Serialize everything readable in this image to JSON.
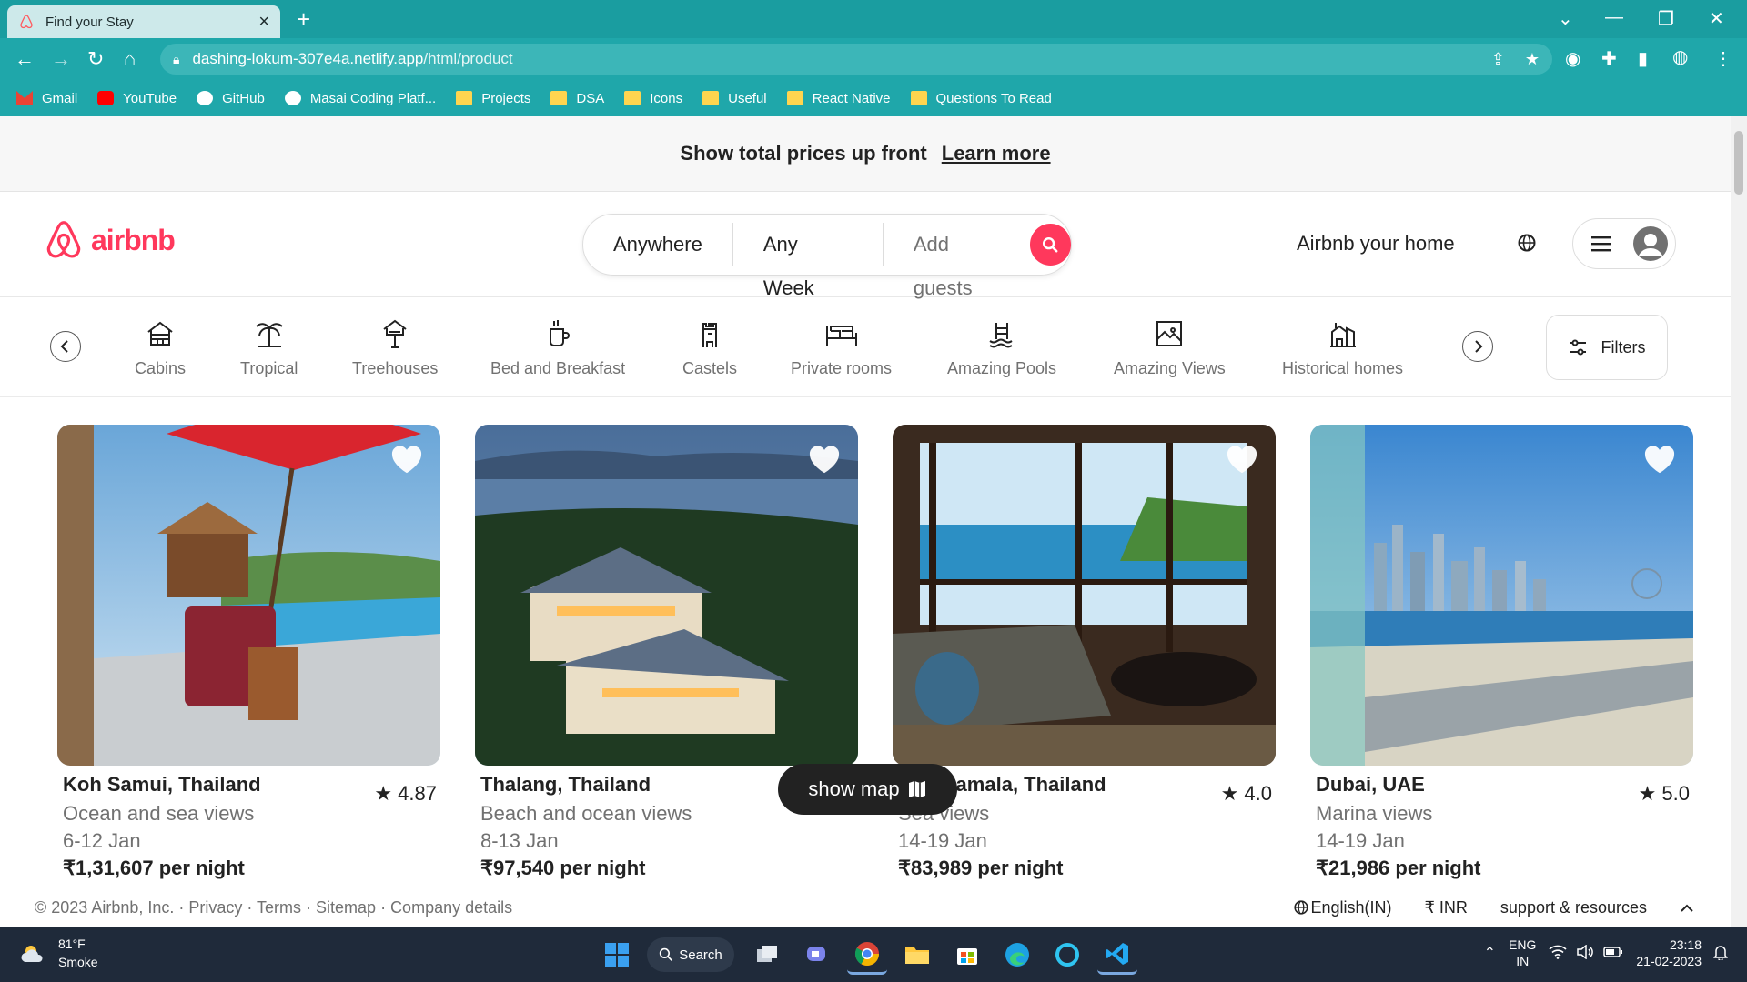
{
  "browser": {
    "tab_title": "Find your Stay",
    "url_host": "dashing-lokum-307e4a.netlify.app",
    "url_path": "/html/product",
    "bookmarks": [
      {
        "label": "Gmail",
        "icon": "gmail-icon"
      },
      {
        "label": "YouTube",
        "icon": "youtube-icon"
      },
      {
        "label": "GitHub",
        "icon": "github-icon"
      },
      {
        "label": "Masai Coding Platf...",
        "icon": "masai-icon"
      },
      {
        "label": "Projects",
        "icon": "folder-icon"
      },
      {
        "label": "DSA",
        "icon": "folder-icon"
      },
      {
        "label": "Icons",
        "icon": "folder-icon"
      },
      {
        "label": "Useful",
        "icon": "folder-icon"
      },
      {
        "label": "React Native",
        "icon": "folder-icon"
      },
      {
        "label": "Questions To Read",
        "icon": "folder-icon"
      }
    ]
  },
  "banner": {
    "message": "Show total prices up front",
    "link": "Learn more"
  },
  "header": {
    "logo_text": "airbnb",
    "search": {
      "anywhere": "Anywhere",
      "week": "Any Week",
      "guests": "Add guests"
    },
    "host_link": "Airbnb your home"
  },
  "categories": {
    "items": [
      {
        "label": "Cabins",
        "icon": "cabin-icon"
      },
      {
        "label": "Tropical",
        "icon": "palm-tree-icon"
      },
      {
        "label": "Treehouses",
        "icon": "treehouse-icon"
      },
      {
        "label": "Bed and Breakfast",
        "icon": "coffee-icon"
      },
      {
        "label": "Castels",
        "icon": "castle-icon"
      },
      {
        "label": "Private rooms",
        "icon": "bed-icon"
      },
      {
        "label": "Amazing Pools",
        "icon": "pool-icon"
      },
      {
        "label": "Amazing Views",
        "icon": "view-icon"
      },
      {
        "label": "Historical homes",
        "icon": "historical-icon"
      }
    ],
    "filters_label": "Filters"
  },
  "listings": [
    {
      "location": "Koh Samui, Thailand",
      "rating": "4.87",
      "description": "Ocean and sea views",
      "dates": "6-12 Jan",
      "price": "₹1,31,607 per night"
    },
    {
      "location": "Thalang, Thailand",
      "rating": "",
      "description": "Beach and ocean views",
      "dates": "8-13 Jan",
      "price": "₹97,540 per night"
    },
    {
      "location": "Ban Kamala, Thailand",
      "rating": "4.0",
      "description": "Sea views",
      "dates": "14-19 Jan",
      "price": "₹83,989 per night"
    },
    {
      "location": "Dubai, UAE",
      "rating": "5.0",
      "description": "Marina views",
      "dates": "14-19 Jan",
      "price": "₹21,986 per night"
    }
  ],
  "show_map_label": "show map",
  "footer": {
    "copyright": "© 2023 Airbnb, Inc. · Privacy · Terms · Sitemap · Company details",
    "language": "English(IN)",
    "currency": "₹ INR",
    "support": "support & resources"
  },
  "taskbar": {
    "weather_temp": "81°F",
    "weather_desc": "Smoke",
    "search_label": "Search",
    "lang_top": "ENG",
    "lang_bottom": "IN",
    "time": "23:18",
    "date": "21-02-2023"
  },
  "colors": {
    "brand": "#ff385c",
    "chrome": "#1fa7aa"
  }
}
